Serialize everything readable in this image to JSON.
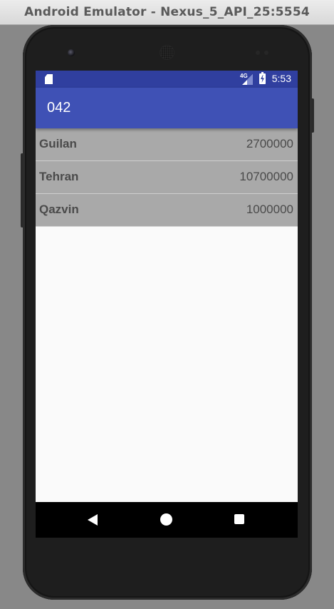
{
  "window": {
    "title": "Android Emulator - Nexus_5_API_25:5554"
  },
  "status_bar": {
    "network": "4G",
    "time": "5:53",
    "icons": [
      "sd-card-icon",
      "signal-icon",
      "battery-charging-icon"
    ]
  },
  "app_bar": {
    "title": "042",
    "color": "#3f51b5",
    "status_color": "#303f9f"
  },
  "list": {
    "items": [
      {
        "name": "Guilan",
        "value": "2700000"
      },
      {
        "name": "Tehran",
        "value": "10700000"
      },
      {
        "name": "Qazvin",
        "value": "1000000"
      }
    ],
    "row_color": "#a9a9a9"
  },
  "nav_bar": {
    "icons": [
      "back-icon",
      "home-icon",
      "recents-icon"
    ]
  }
}
